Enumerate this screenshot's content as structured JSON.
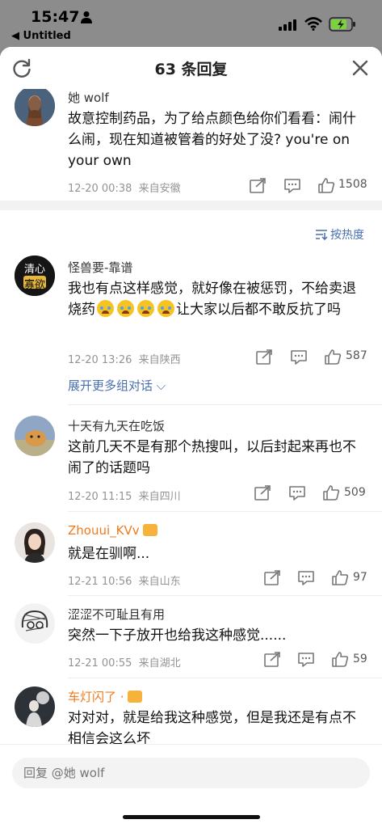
{
  "status_bar": {
    "time": "15:47",
    "back_app": "◀ Untitled"
  },
  "sheet": {
    "title": "63 条回复",
    "sort_label": "按热度",
    "expand_label": "展开更多组对话 ⌵"
  },
  "parent_comment": {
    "name": "她 wolf",
    "content": "故意控制药品，为了给点颜色给你们看看：闹什么闹，现在知道被管着的好处了没? you're on your own",
    "time": "12-20 00:38",
    "location": "来自安徽",
    "likes": "1508"
  },
  "replies": [
    {
      "name": "怪兽要-靠谱",
      "content_a": "我也有点这样感觉，就好像在被惩罚，不给卖退烧药",
      "content_b": "让大家以后都不敢反抗了吗",
      "time": "12-20 13:26",
      "location": "来自陕西",
      "likes": "587",
      "avatar_text_top": "清心",
      "avatar_text_bottom": "寡欲"
    },
    {
      "name": "十天有九天在吃饭",
      "content": "这前几天不是有那个热搜叫，以后封起来再也不闹了的话题吗",
      "time": "12-20 11:15",
      "location": "来自四川",
      "likes": "509"
    },
    {
      "name": "Zhouui_KVv",
      "content": "就是在驯啊...",
      "time": "12-21 10:56",
      "location": "来自山东",
      "likes": "97"
    },
    {
      "name": "涩涩不可耻且有用",
      "content": "突然一下子放开也给我这种感觉......",
      "time": "12-21 00:55",
      "location": "来自湖北",
      "likes": "59"
    },
    {
      "name": "车灯闪了 ·",
      "content": "对对对，就是给我这种感觉，但是我还是有点不相信会这么坏"
    }
  ],
  "reply_bar": {
    "placeholder": "回复 @她 wolf"
  },
  "colors": {
    "link": "#4a6fae",
    "vip_name": "#f07a1c",
    "meta": "#939393"
  },
  "icons": [
    "person-icon",
    "signal-icon",
    "wifi-icon",
    "battery-icon",
    "refresh-icon",
    "close-icon",
    "share-icon",
    "comment-icon",
    "like-icon",
    "sort-icon",
    "vip-badge-icon",
    "crying-emoji-icon"
  ]
}
